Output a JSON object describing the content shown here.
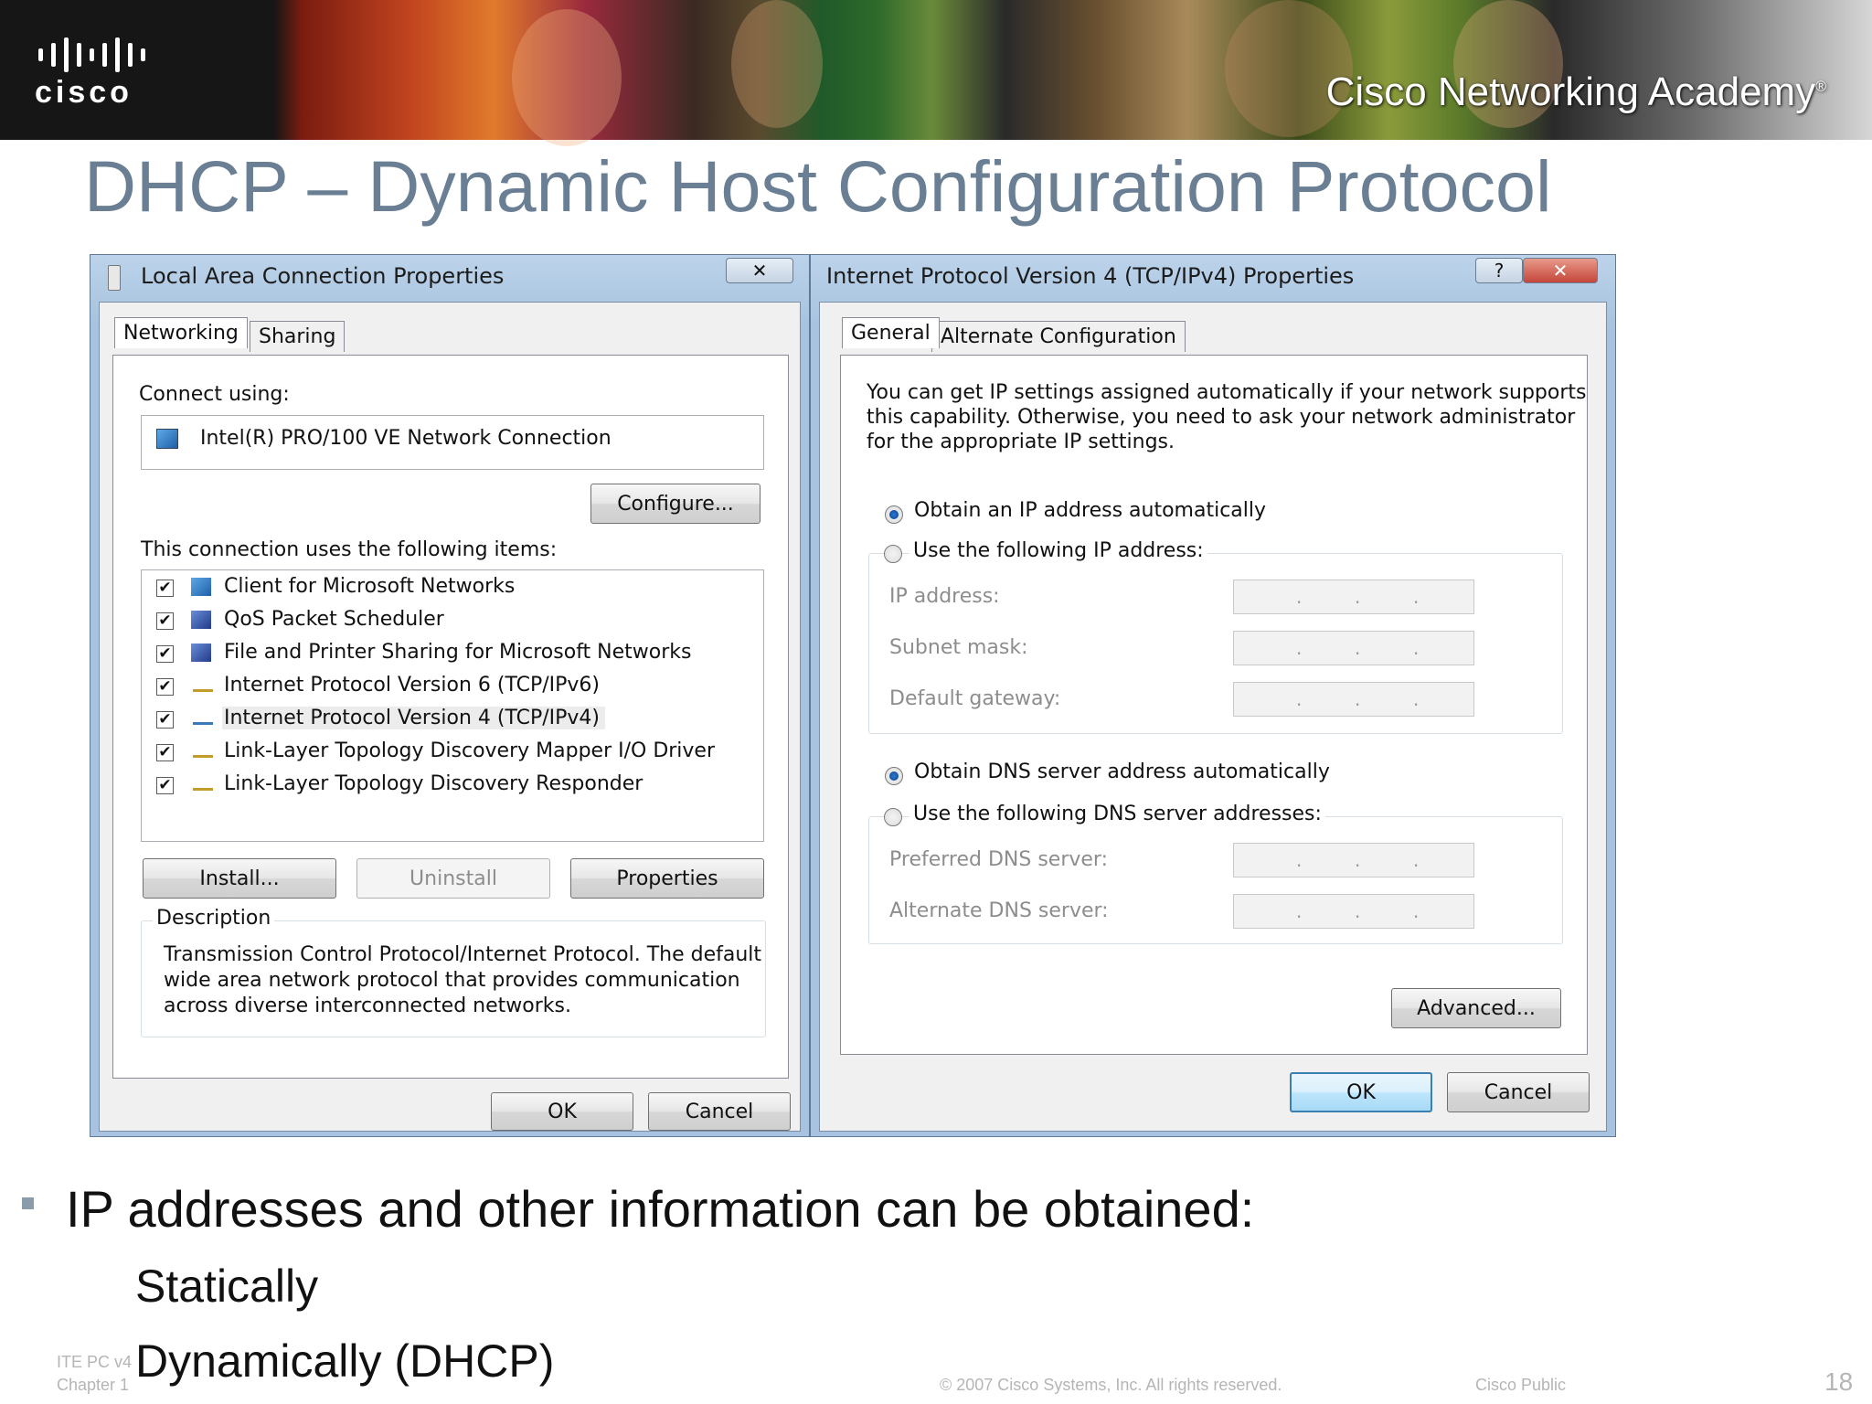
{
  "slide": {
    "title": "DHCP – Dynamic Host Configuration Protocol",
    "brand_logo": "cisco",
    "academy": "Cisco Networking Academy",
    "academy_mark": "®",
    "bullet": "IP addresses and other information can be obtained:",
    "sub_bullets": [
      "Statically",
      "Dynamically (DHCP)"
    ],
    "footer": {
      "course": "ITE PC v4",
      "chapter": "Chapter 1",
      "copyright": "© 2007 Cisco Systems, Inc. All rights reserved.",
      "classification": "Cisco Public",
      "page": "18"
    }
  },
  "left_dialog": {
    "title": "Local Area Connection Properties",
    "close_glyph": "✕",
    "tabs": [
      "Networking",
      "Sharing"
    ],
    "connect_using_label": "Connect using:",
    "adapter": "Intel(R) PRO/100 VE Network Connection",
    "configure_button": "Configure...",
    "items_label": "This connection uses the following items:",
    "items": [
      {
        "label": "Client for Microsoft Networks",
        "checked": true,
        "icon": "network-client-icon"
      },
      {
        "label": "QoS Packet Scheduler",
        "checked": true,
        "icon": "service-icon"
      },
      {
        "label": "File and Printer Sharing for Microsoft Networks",
        "checked": true,
        "icon": "service-icon"
      },
      {
        "label": "Internet Protocol Version 6 (TCP/IPv6)",
        "checked": true,
        "icon": "protocol-icon"
      },
      {
        "label": "Internet Protocol Version 4 (TCP/IPv4)",
        "checked": true,
        "icon": "protocol-icon",
        "selected": true
      },
      {
        "label": "Link-Layer Topology Discovery Mapper I/O Driver",
        "checked": true,
        "icon": "protocol-icon"
      },
      {
        "label": "Link-Layer Topology Discovery Responder",
        "checked": true,
        "icon": "protocol-icon"
      }
    ],
    "check_glyph": "✔",
    "install_button": "Install...",
    "uninstall_button": "Uninstall",
    "properties_button": "Properties",
    "description_label": "Description",
    "description_lines": [
      "Transmission Control Protocol/Internet Protocol. The default",
      "wide area network protocol that provides communication",
      "across diverse interconnected networks."
    ],
    "ok_button": "OK",
    "cancel_button": "Cancel"
  },
  "right_dialog": {
    "title": "Internet Protocol Version 4 (TCP/IPv4) Properties",
    "help_glyph": "?",
    "close_glyph": "✕",
    "tabs": [
      "General",
      "Alternate Configuration"
    ],
    "intro_lines": [
      "You can get IP settings assigned automatically if your network supports",
      "this capability. Otherwise, you need to ask your network administrator",
      "for the appropriate IP settings."
    ],
    "obtain_ip_auto": "Obtain an IP address automatically",
    "use_following_ip": "Use the following IP address:",
    "ip_address_label": "IP address:",
    "subnet_mask_label": "Subnet mask:",
    "default_gateway_label": "Default gateway:",
    "obtain_dns_auto": "Obtain DNS server address automatically",
    "use_following_dns": "Use the following DNS server addresses:",
    "preferred_dns_label": "Preferred DNS server:",
    "alternate_dns_label": "Alternate DNS server:",
    "ip_dot": ".",
    "advanced_button": "Advanced...",
    "ok_button": "OK",
    "cancel_button": "Cancel",
    "ip_mode": "automatic",
    "dns_mode": "automatic"
  },
  "colors": {
    "title_color": "#6a7f93",
    "dialog_frame": "#a7c3df",
    "close_button": "#c4453a",
    "bullet_square": "#8a9baa"
  }
}
